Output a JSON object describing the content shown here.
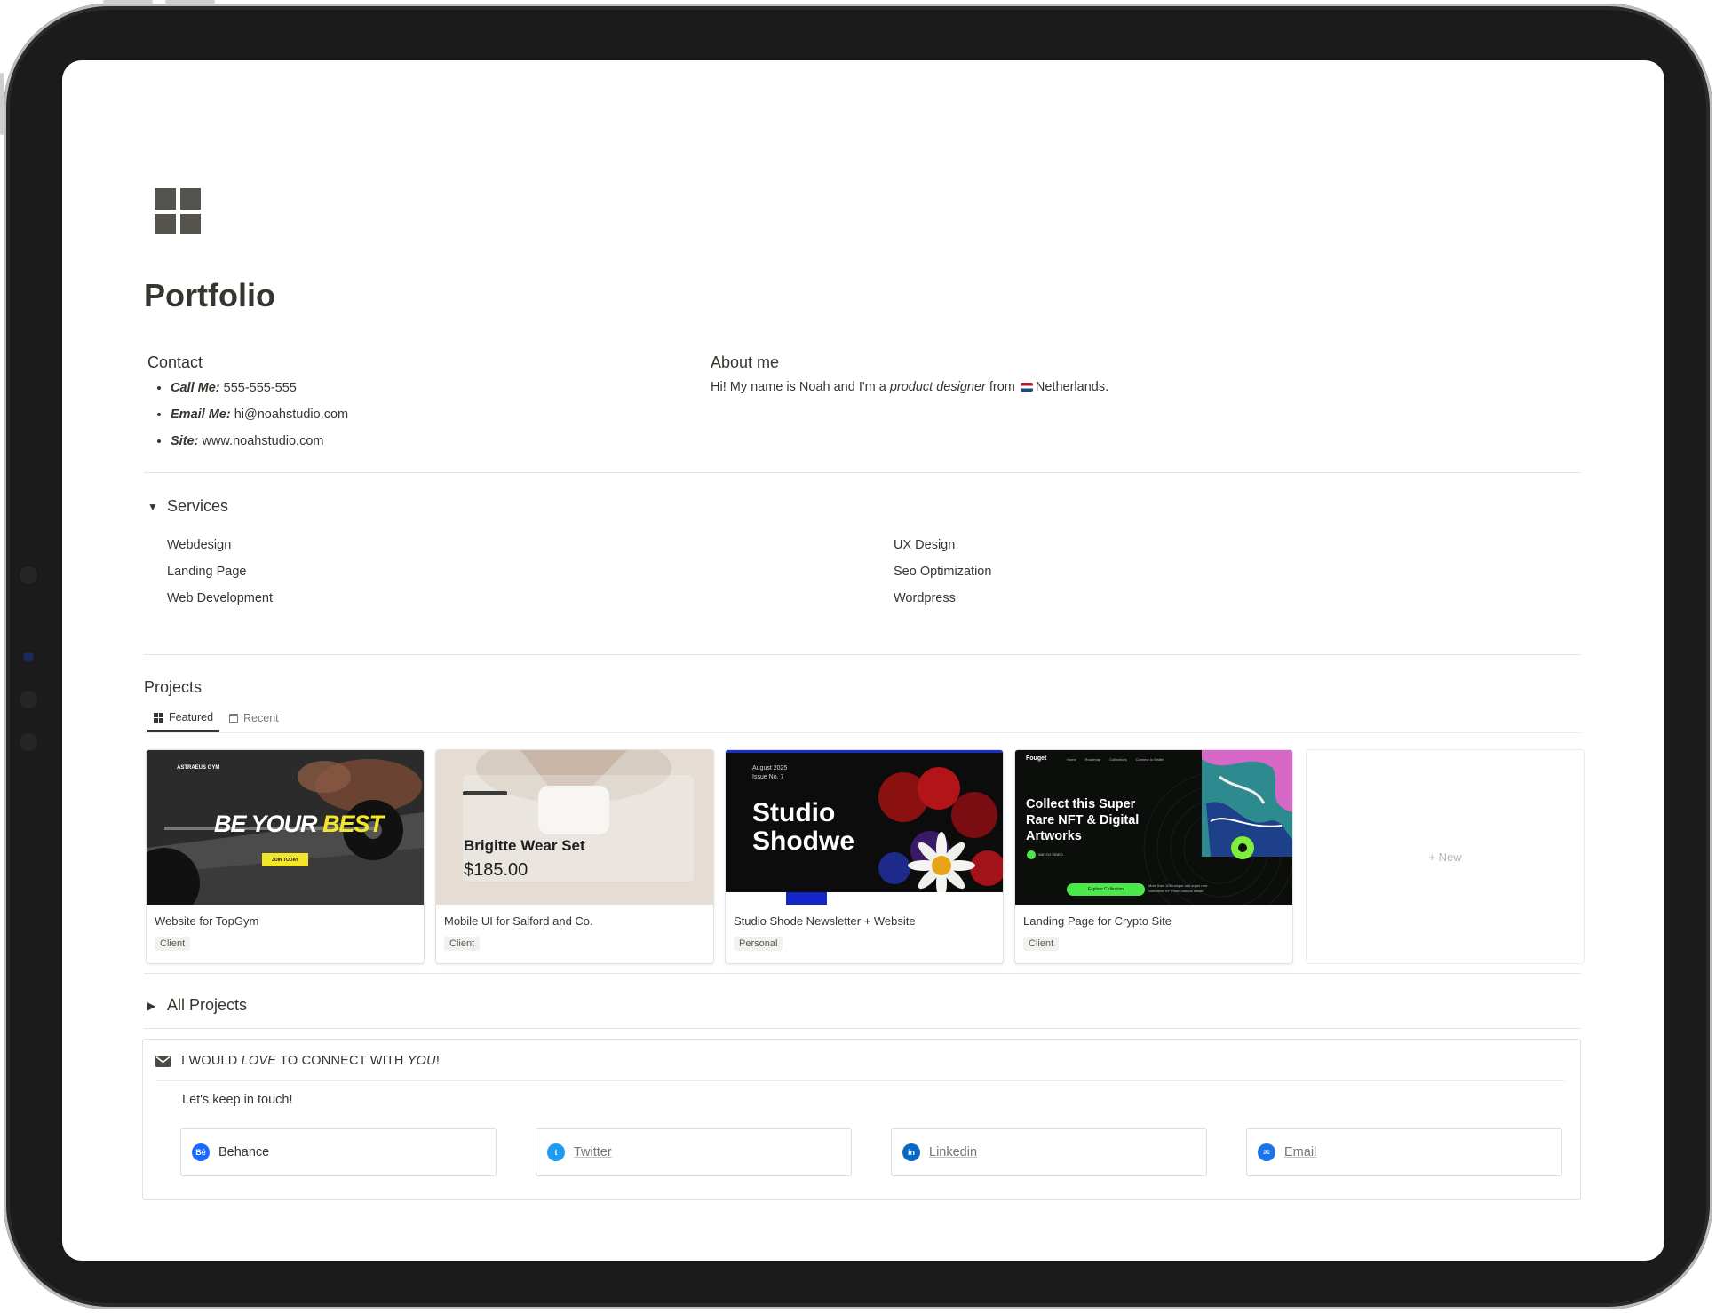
{
  "page": {
    "title": "Portfolio",
    "icon": "gallery-grid-icon"
  },
  "contact": {
    "heading": "Contact",
    "items": [
      {
        "label": "Call Me:",
        "value": "555-555-555"
      },
      {
        "label": "Email Me:",
        "value": "hi@noahstudio.com"
      },
      {
        "label": "Site:",
        "value": "www.noahstudio.com"
      }
    ]
  },
  "about": {
    "heading": "About me",
    "text_before": "Hi! My name is Noah and I'm a ",
    "emphasis": "product designer",
    "text_after": " from ",
    "country": "Netherlands."
  },
  "services": {
    "heading": "Services",
    "left": [
      "Webdesign",
      "Landing Page",
      "Web Development"
    ],
    "right": [
      "UX Design",
      "Seo Optimization",
      "Wordpress"
    ]
  },
  "projects": {
    "heading": "Projects",
    "tabs": [
      {
        "label": "Featured",
        "icon": "gallery-icon",
        "active": true
      },
      {
        "label": "Recent",
        "icon": "calendar-icon",
        "active": false
      }
    ],
    "cards": [
      {
        "title": "Website for TopGym",
        "tag": "Client",
        "thumb": {
          "brand": "ASTRAEUS GYM",
          "headline_a": "BE YOUR",
          "headline_b": "BEST",
          "cta": "JOIN TODAY"
        }
      },
      {
        "title": "Mobile UI for Salford and Co.",
        "tag": "Client",
        "thumb": {
          "product": "Brigitte Wear Set",
          "price": "$185.00"
        }
      },
      {
        "title": "Studio Shode Newsletter + Website",
        "tag": "Personal",
        "thumb": {
          "date": "August 2025",
          "issue": "Issue No. 7",
          "line1": "Studio",
          "line2": "Shodwe"
        }
      },
      {
        "title": "Landing Page for Crypto Site",
        "tag": "Client",
        "thumb": {
          "brand": "Fouget",
          "nav": [
            "Home",
            "Roadmap",
            "Collections",
            "Connect to Wallet"
          ],
          "headline": "Collect this Super Rare NFT & Digital Artworks",
          "watch": "WATCH VIDEO",
          "cta": "Explore Collection",
          "note": "More than 10K unique and super rare collectible NFT from various artists."
        }
      }
    ],
    "new_label": "+ New"
  },
  "all_projects": {
    "heading": "All Projects"
  },
  "connect": {
    "pre": "I WOULD ",
    "love": "LOVE",
    "mid": " TO CONNECT WITH ",
    "you": "YOU",
    "post": "!",
    "subtitle": "Let's keep in touch!",
    "links": [
      {
        "label": "Behance",
        "icon": "behance-icon",
        "color": "#1769ff",
        "glyph": "Bē"
      },
      {
        "label": "Twitter",
        "icon": "twitter-icon",
        "color": "#1d9bf0",
        "glyph": "t"
      },
      {
        "label": "Linkedin",
        "icon": "linkedin-icon",
        "color": "#0a66c2",
        "glyph": "in"
      },
      {
        "label": "Email",
        "icon": "email-icon",
        "color": "#1a73e8",
        "glyph": "✉"
      }
    ]
  }
}
